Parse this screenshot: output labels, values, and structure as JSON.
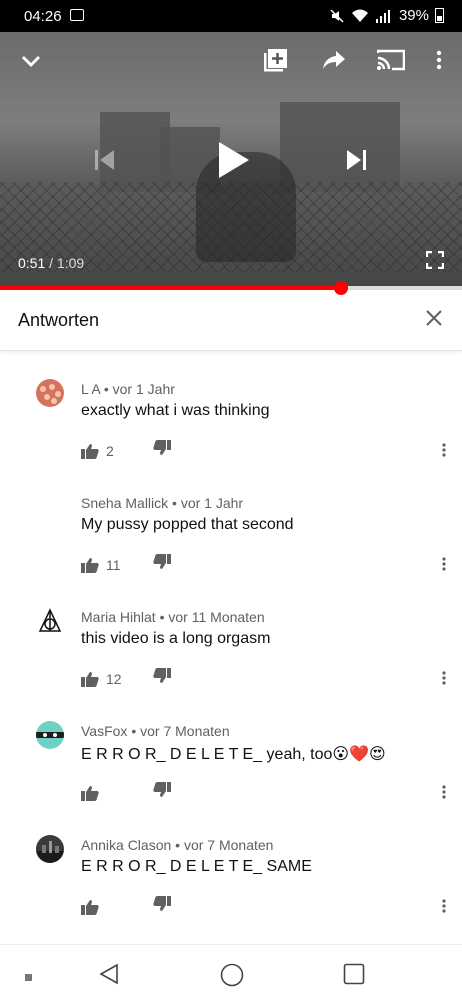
{
  "status_bar": {
    "time": "04:26",
    "battery": "39%"
  },
  "video": {
    "current_time": "0:51",
    "separator": " / ",
    "duration": "1:09",
    "progress": 0.738
  },
  "replies_panel": {
    "title": "Antworten"
  },
  "comments": [
    {
      "author": "L A",
      "age": "vor 1 Jahr",
      "text": "exactly what i was thinking",
      "likes": "2"
    },
    {
      "author": "Sneha Mallick",
      "age": "vor 1 Jahr",
      "text": "My pussy popped that second",
      "likes": "11"
    },
    {
      "author": "Maria Hihlat",
      "age": "vor 11 Monaten",
      "text": "this video is a long orgasm",
      "likes": "12"
    },
    {
      "author": "VasFox",
      "age": "vor 7 Monaten",
      "text": "E R R O R_ D E L E T E_ yeah, too",
      "emojis": "😮❤️😍",
      "likes": ""
    },
    {
      "author": "Annika Clason",
      "age": "vor 7 Monaten",
      "text": "E R R O R_ D E L E T E_ SAME",
      "likes": ""
    }
  ],
  "meta_separator": " • ",
  "colors": {
    "accent": "#ff0000",
    "meta": "#606060",
    "text": "#111111"
  }
}
